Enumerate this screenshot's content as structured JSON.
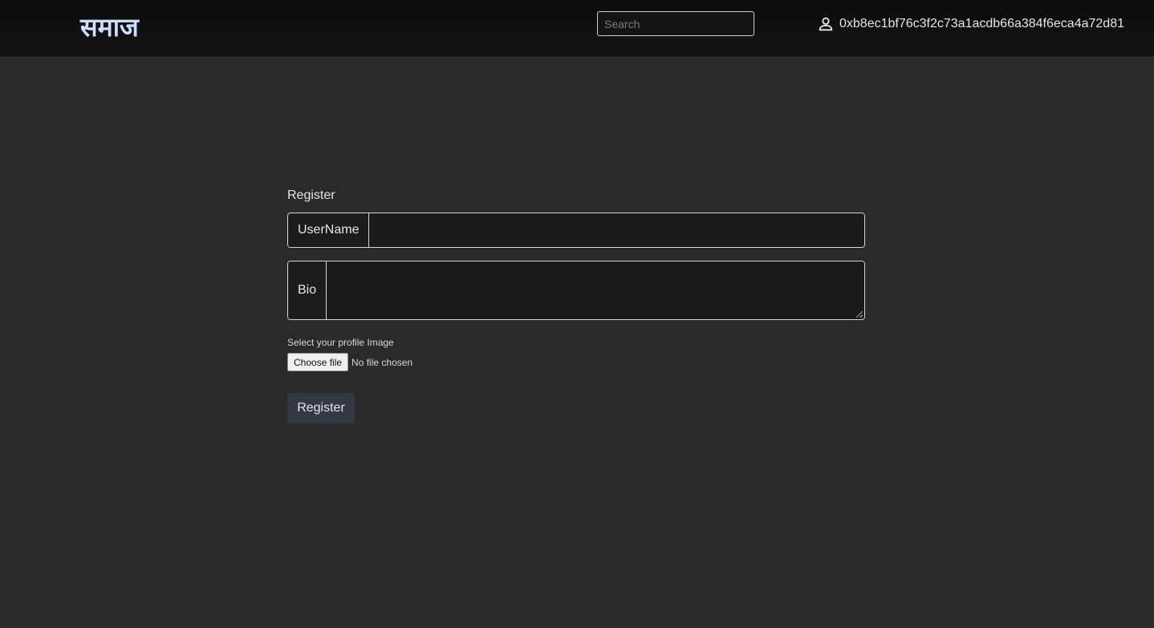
{
  "header": {
    "brand": "समाज",
    "search_placeholder": "Search",
    "account_address": "0xb8ec1bf76c3f2c73a1acdb66a384f6eca4a72d81",
    "account_icon": "user-icon"
  },
  "form": {
    "title": "Register",
    "username_label": "UserName",
    "username_value": "",
    "bio_label": "Bio",
    "bio_value": "",
    "file_label": "Select your profile Image",
    "choose_file_label": "Choose file",
    "file_status": "No file chosen",
    "submit_label": "Register"
  },
  "colors": {
    "page_bg": "#2a2a2a",
    "nav_bg": "#111111",
    "brand": "#cfe0ff",
    "button_bg": "#333944"
  }
}
